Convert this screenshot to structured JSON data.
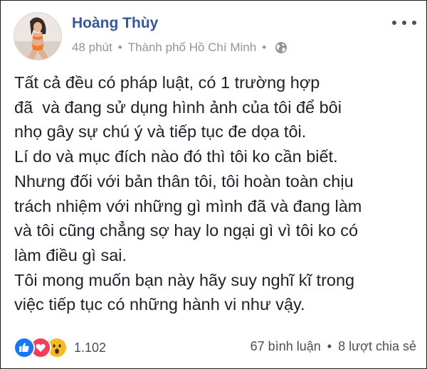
{
  "author": {
    "name": "Hoàng Thùy"
  },
  "meta": {
    "time": "48 phút",
    "separator": "•",
    "location": "Thành phố Hồ Chí Minh",
    "privacy_icon": "globe-icon"
  },
  "post": {
    "lines": [
      "Tất cả đều có pháp luật, có 1 trường hợp",
      "đã  và đang sử dụng hình ảnh của tôi để bôi",
      "nhọ gây sự chú ý và tiếp tục đe dọa tôi.",
      "Lí do và mục đích nào đó thì tôi ko cần biết.",
      "Nhưng đối với bản thân tôi, tôi hoàn toàn chịu",
      "trách nhiệm với những gì mình đã và đang làm",
      "và tôi cũng chẳng sợ hay lo ngại gì vì tôi ko có",
      "làm điều gì sai.",
      "Tôi mong muốn bạn này hãy suy nghĩ kĩ trong",
      "việc tiếp tục có những hành vi như vậy."
    ]
  },
  "reactions": {
    "icons": [
      "like-icon",
      "love-icon",
      "wow-icon"
    ],
    "count": "1.102"
  },
  "stats": {
    "comments": "67 bình luận",
    "separator": "•",
    "shares": "8 lượt chia sẻ"
  },
  "colors": {
    "name": "#365899",
    "meta": "#90949c",
    "text": "#1d2129",
    "like": "#1877f2",
    "love": "#f33e58",
    "wow": "#f7b928"
  }
}
